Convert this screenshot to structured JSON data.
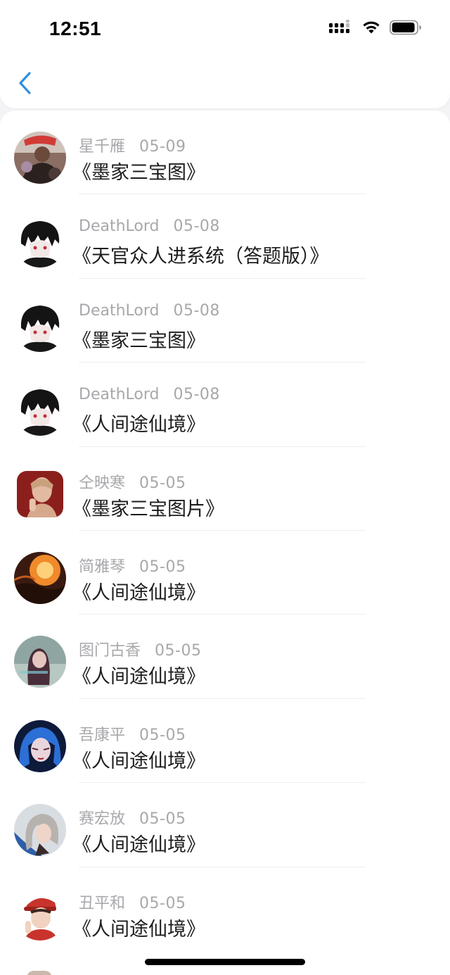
{
  "status_bar": {
    "time": "12:51",
    "icons": [
      "cellular-signal-icon",
      "wifi-icon",
      "battery-icon"
    ]
  },
  "nav": {
    "back_icon": "chevron-left-icon",
    "accent_color": "#2f8fe0"
  },
  "items": [
    {
      "name": "星千雁",
      "date": "05-09",
      "title": "《墨家三宝图》",
      "avatar": "avatar-red-cap-photo"
    },
    {
      "name": "DeathLord",
      "date": "05-08",
      "title": "《天官众人进系统（答题版）》",
      "avatar": "avatar-anime-dark-hair"
    },
    {
      "name": "DeathLord",
      "date": "05-08",
      "title": "《墨家三宝图》",
      "avatar": "avatar-anime-dark-hair"
    },
    {
      "name": "DeathLord",
      "date": "05-08",
      "title": "《人间途仙境》",
      "avatar": "avatar-anime-dark-hair"
    },
    {
      "name": "仝映寒",
      "date": "05-05",
      "title": "《墨家三宝图片》",
      "avatar": "avatar-red-portrait"
    },
    {
      "name": "简雅琴",
      "date": "05-05",
      "title": "《人间途仙境》",
      "avatar": "avatar-fire-sky"
    },
    {
      "name": "图门古香",
      "date": "05-05",
      "title": "《人间途仙境》",
      "avatar": "avatar-teal-girl"
    },
    {
      "name": "吾康平",
      "date": "05-05",
      "title": "《人间途仙境》",
      "avatar": "avatar-blue-hair"
    },
    {
      "name": "赛宏放",
      "date": "05-05",
      "title": "《人间途仙境》",
      "avatar": "avatar-silver-hair"
    },
    {
      "name": "丑平和",
      "date": "05-05",
      "title": "《人间途仙境》",
      "avatar": "avatar-red-hat-boy"
    }
  ],
  "colors": {
    "meta_text": "#a8a8ac",
    "title_text": "#1c1c1e",
    "divider": "#eeeeef",
    "page_bg": "#f4f4f6"
  }
}
